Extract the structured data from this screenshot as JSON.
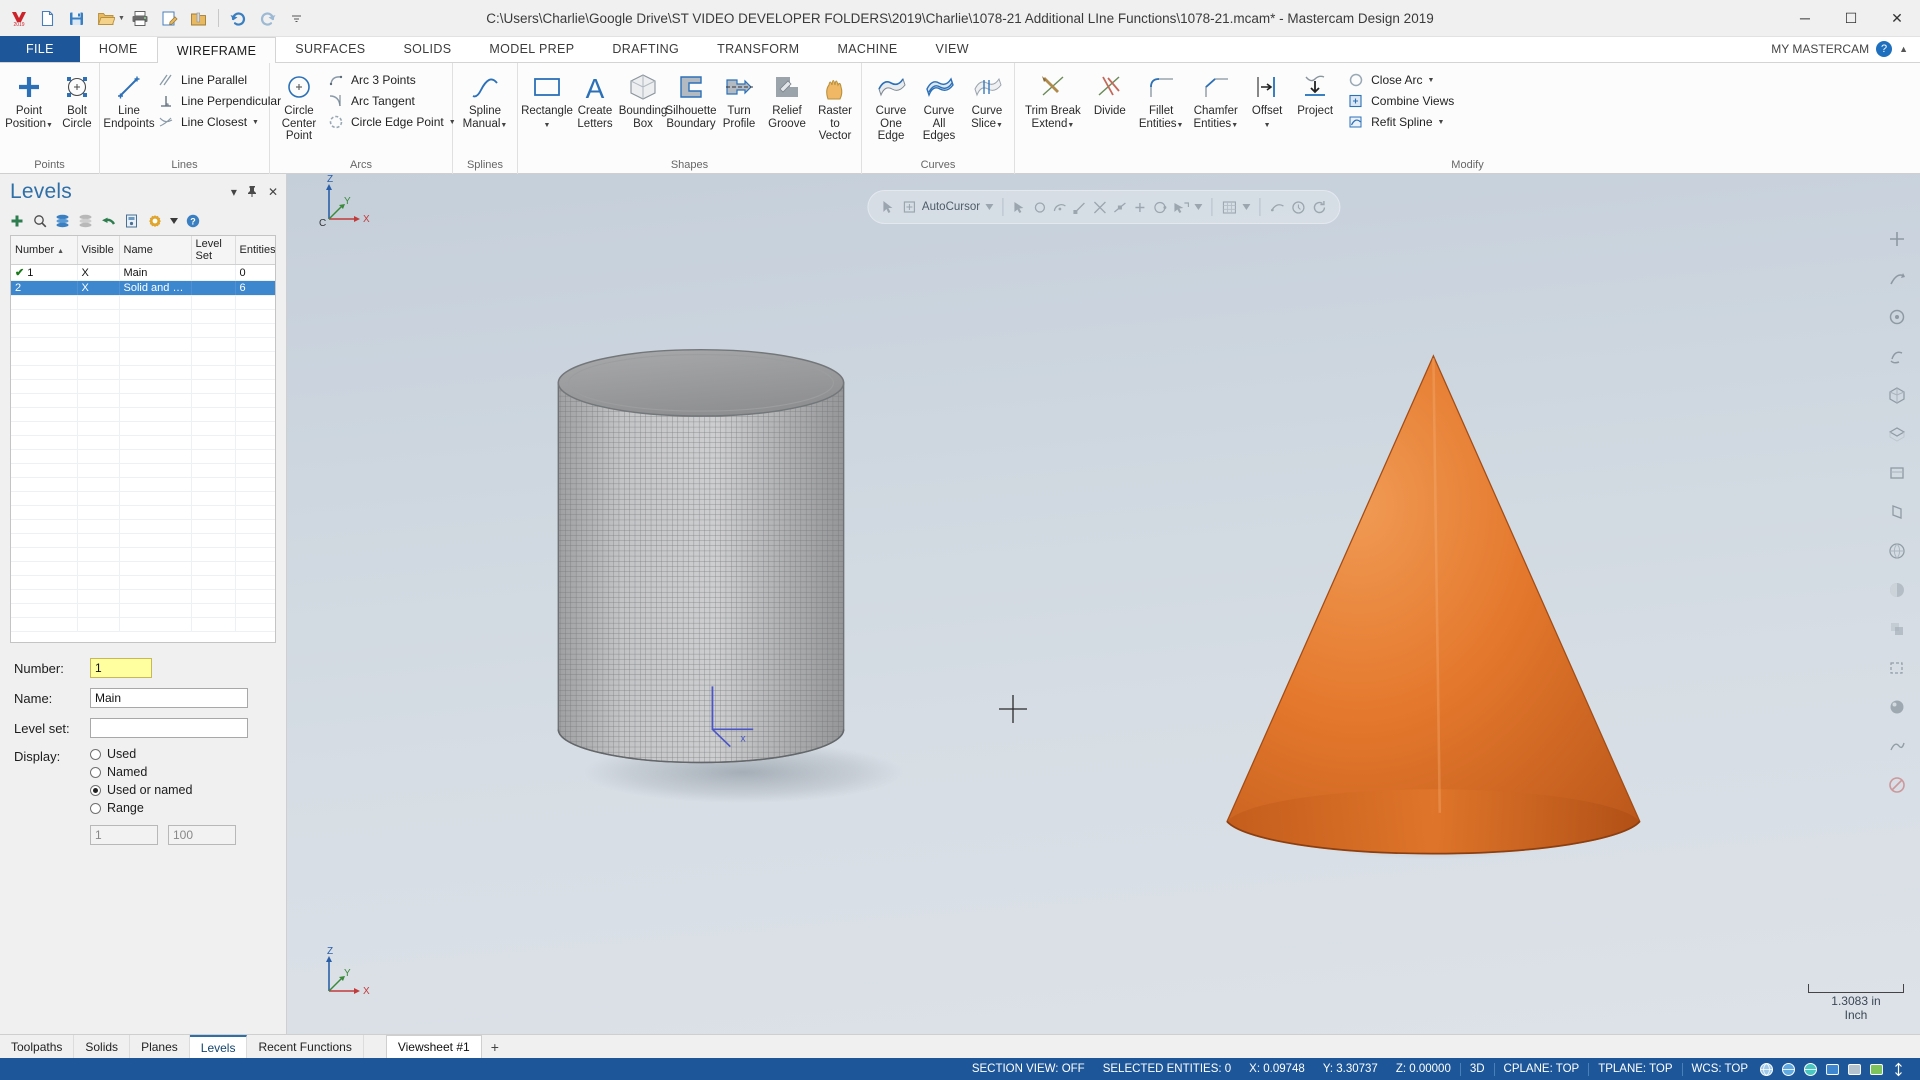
{
  "titlebar": {
    "title": "C:\\Users\\Charlie\\Google Drive\\ST VIDEO DEVELOPER FOLDERS\\2019\\Charlie\\1078-21 Additional LIne Functions\\1078-21.mcam* - Mastercam Design 2019",
    "quick_access": [
      {
        "name": "mastercam-logo-icon",
        "label": "Mastercam"
      },
      {
        "name": "new-file-icon",
        "label": "New"
      },
      {
        "name": "save-icon",
        "label": "Save"
      },
      {
        "name": "open-folder-icon",
        "label": "Open"
      },
      {
        "name": "print-icon",
        "label": "Print"
      },
      {
        "name": "print-preview-icon",
        "label": "Print Preview"
      },
      {
        "name": "zip2go-icon",
        "label": "Zip2Go"
      },
      {
        "name": "undo-icon",
        "label": "Undo"
      },
      {
        "name": "redo-icon",
        "label": "Redo"
      },
      {
        "name": "customize-qat-icon",
        "label": "Customize Quick Access Toolbar"
      }
    ],
    "window_controls": {
      "minimize": "─",
      "maximize": "☐",
      "close": "✕"
    }
  },
  "ribbon_tabs": {
    "file": "FILE",
    "tabs": [
      "HOME",
      "WIREFRAME",
      "SURFACES",
      "SOLIDS",
      "MODEL PREP",
      "DRAFTING",
      "TRANSFORM",
      "MACHINE",
      "VIEW"
    ],
    "active": "WIREFRAME",
    "my_mastercam": "MY MASTERCAM",
    "help": "?"
  },
  "ribbon": {
    "groups": [
      {
        "label": "Points",
        "big_buttons": [
          {
            "name": "point-position-button",
            "label": "Point\nPosition",
            "icon": "plus-icon",
            "has_caret": true
          },
          {
            "name": "bolt-circle-button",
            "label": "Bolt\nCircle",
            "icon": "bolt-circle-icon",
            "has_caret": false
          }
        ],
        "small_buttons": []
      },
      {
        "label": "Lines",
        "big_buttons": [
          {
            "name": "line-endpoints-button",
            "label": "Line\nEndpoints",
            "icon": "line-endpoints-icon",
            "has_caret": false
          }
        ],
        "small_buttons": [
          {
            "name": "line-parallel-button",
            "label": "Line Parallel",
            "icon": "line-parallel-icon",
            "has_caret": false
          },
          {
            "name": "line-perpendicular-button",
            "label": "Line Perpendicular",
            "icon": "line-perpendicular-icon",
            "has_caret": false
          },
          {
            "name": "line-closest-button",
            "label": "Line Closest",
            "icon": "line-closest-icon",
            "has_caret": true
          }
        ]
      },
      {
        "label": "Arcs",
        "big_buttons": [
          {
            "name": "circle-center-point-button",
            "label": "Circle\nCenter Point",
            "icon": "circle-center-icon",
            "has_caret": false
          }
        ],
        "small_buttons": [
          {
            "name": "arc-3-points-button",
            "label": "Arc 3 Points",
            "icon": "arc-3-points-icon",
            "has_caret": false
          },
          {
            "name": "arc-tangent-button",
            "label": "Arc Tangent",
            "icon": "arc-tangent-icon",
            "has_caret": false
          },
          {
            "name": "circle-edge-point-button",
            "label": "Circle Edge Point",
            "icon": "circle-edge-point-icon",
            "has_caret": true
          }
        ]
      },
      {
        "label": "Splines",
        "big_buttons": [
          {
            "name": "spline-manual-button",
            "label": "Spline\nManual",
            "icon": "spline-icon",
            "has_caret": true
          }
        ],
        "small_buttons": []
      },
      {
        "label": "Shapes",
        "big_buttons": [
          {
            "name": "rectangle-button",
            "label": "Rectangle",
            "icon": "rectangle-icon",
            "has_caret": true
          },
          {
            "name": "create-letters-button",
            "label": "Create\nLetters",
            "icon": "letter-a-icon",
            "has_caret": false
          },
          {
            "name": "bounding-box-button",
            "label": "Bounding\nBox",
            "icon": "bounding-box-icon",
            "has_caret": false
          },
          {
            "name": "silhouette-boundary-button",
            "label": "Silhouette\nBoundary",
            "icon": "silhouette-boundary-icon",
            "has_caret": false
          },
          {
            "name": "turn-profile-button",
            "label": "Turn\nProfile",
            "icon": "turn-profile-icon",
            "has_caret": false
          },
          {
            "name": "relief-groove-button",
            "label": "Relief\nGroove",
            "icon": "relief-groove-icon",
            "has_caret": false
          },
          {
            "name": "raster-to-vector-button",
            "label": "Raster to\nVector",
            "icon": "raster-to-vector-icon",
            "has_caret": false
          }
        ],
        "small_buttons": []
      },
      {
        "label": "Curves",
        "big_buttons": [
          {
            "name": "curve-one-edge-button",
            "label": "Curve\nOne Edge",
            "icon": "curve-one-edge-icon",
            "has_caret": false
          },
          {
            "name": "curve-all-edges-button",
            "label": "Curve\nAll Edges",
            "icon": "curve-all-edges-icon",
            "has_caret": false
          },
          {
            "name": "curve-slice-button",
            "label": "Curve\nSlice",
            "icon": "curve-slice-icon",
            "has_caret": true
          }
        ],
        "small_buttons": []
      },
      {
        "label": "Modify",
        "big_buttons": [
          {
            "name": "trim-break-extend-button",
            "label": "Trim Break\nExtend",
            "icon": "trim-break-extend-icon",
            "has_caret": true
          },
          {
            "name": "divide-button",
            "label": "Divide",
            "icon": "divide-icon",
            "has_caret": false
          },
          {
            "name": "fillet-entities-button",
            "label": "Fillet\nEntities",
            "icon": "fillet-icon",
            "has_caret": true
          },
          {
            "name": "chamfer-entities-button",
            "label": "Chamfer\nEntities",
            "icon": "chamfer-icon",
            "has_caret": true
          },
          {
            "name": "offset-button",
            "label": "Offset",
            "icon": "offset-icon",
            "has_caret": true
          },
          {
            "name": "project-button",
            "label": "Project",
            "icon": "project-icon",
            "has_caret": false
          }
        ],
        "small_buttons": [
          {
            "name": "close-arc-button",
            "label": "Close Arc",
            "icon": "close-arc-icon",
            "has_caret": true
          },
          {
            "name": "combine-views-button",
            "label": "Combine Views",
            "icon": "combine-views-icon",
            "has_caret": false
          },
          {
            "name": "refit-spline-button",
            "label": "Refit Spline",
            "icon": "refit-spline-icon",
            "has_caret": true
          }
        ]
      }
    ]
  },
  "levels_panel": {
    "title": "Levels",
    "header_icons": [
      {
        "name": "panel-dropdown-icon",
        "glyph": "▾"
      },
      {
        "name": "panel-pin-icon",
        "glyph": "📌"
      },
      {
        "name": "panel-close-icon",
        "glyph": "✕"
      }
    ],
    "toolbar_icons": [
      {
        "name": "add-level-icon",
        "label": "Add new level"
      },
      {
        "name": "find-level-icon",
        "label": "Find"
      },
      {
        "name": "visible-levels-icon",
        "label": "Make all levels visible"
      },
      {
        "name": "hide-levels-icon",
        "label": "Make all levels invisible"
      },
      {
        "name": "undo-levels-icon",
        "label": "Undo"
      },
      {
        "name": "level-options-icon",
        "label": "Level options"
      },
      {
        "name": "settings-gear-icon",
        "label": "Settings"
      },
      {
        "name": "settings-caret-icon",
        "label": "More"
      },
      {
        "name": "help-circle-icon",
        "label": "Help"
      }
    ],
    "table": {
      "columns": [
        "Number",
        "Visible",
        "Name",
        "Level Set",
        "Entities"
      ],
      "sort_column": "Number",
      "sort_dir": "asc",
      "rows": [
        {
          "check": "✔",
          "number": "1",
          "visible": "X",
          "name": "Main",
          "level_set": "",
          "entities": "0",
          "selected": false
        },
        {
          "check": "",
          "number": "2",
          "visible": "X",
          "name": "Solid and Sur...",
          "level_set": "",
          "entities": "6",
          "selected": true
        }
      ]
    },
    "fields": {
      "number_label": "Number:",
      "number_value": "1",
      "name_label": "Name:",
      "name_value": "Main",
      "level_set_label": "Level set:",
      "level_set_value": "",
      "display_label": "Display:",
      "display_options": [
        {
          "label": "Used",
          "selected": false
        },
        {
          "label": "Named",
          "selected": false
        },
        {
          "label": "Used or named",
          "selected": true
        },
        {
          "label": "Range",
          "selected": false
        }
      ],
      "range_from": "1",
      "range_to": "100"
    }
  },
  "viewport": {
    "autocursor": {
      "label": "AutoCursor",
      "items": [
        {
          "name": "autocursor-select-icon"
        },
        {
          "name": "autocursor-point-icon"
        },
        {
          "name": "autocursor-dropdown-caret"
        },
        {
          "name": "snap-origin-icon"
        },
        {
          "name": "snap-arc-center-icon"
        },
        {
          "name": "snap-endpoint-icon"
        },
        {
          "name": "snap-intersection-icon"
        },
        {
          "name": "snap-midpoint-icon"
        },
        {
          "name": "snap-point-icon"
        },
        {
          "name": "snap-quadrant-icon"
        },
        {
          "name": "snap-nearest-icon"
        },
        {
          "name": "snap-caret-icon"
        },
        {
          "name": "grid-snap-icon"
        },
        {
          "name": "grid-caret-icon"
        },
        {
          "name": "measure-icon"
        },
        {
          "name": "analyze-icon"
        },
        {
          "name": "refresh-icon"
        }
      ]
    },
    "triad_top": {
      "z": "Z",
      "y": "Y",
      "x": "X",
      "origin": "C"
    },
    "triad_bottom": {
      "z": "Z",
      "y": "Y",
      "x": "X"
    },
    "scale": {
      "value": "1.3083 in",
      "unit": "Inch"
    },
    "right_toolbar": [
      {
        "name": "fit-screen-icon"
      },
      {
        "name": "zoom-window-icon"
      },
      {
        "name": "zoom-target-icon"
      },
      {
        "name": "dynamic-rotate-icon"
      },
      {
        "name": "isometric-view-icon"
      },
      {
        "name": "top-view-icon"
      },
      {
        "name": "front-view-icon"
      },
      {
        "name": "right-view-icon"
      },
      {
        "name": "wireframe-shading-icon"
      },
      {
        "name": "shaded-view-icon"
      },
      {
        "name": "translucency-icon"
      },
      {
        "name": "hidden-lines-icon"
      },
      {
        "name": "material-icon"
      },
      {
        "name": "toolpath-display-icon"
      },
      {
        "name": "blank-entity-icon"
      }
    ],
    "models": [
      {
        "name": "cylinder-model",
        "color": "#b6b6b6",
        "shading": "wireframe-mesh"
      },
      {
        "name": "cone-model",
        "color": "#e0762a",
        "shading": "shaded"
      }
    ]
  },
  "bottom_tabs": {
    "tabs": [
      {
        "label": "Toolpaths",
        "active": false
      },
      {
        "label": "Solids",
        "active": false
      },
      {
        "label": "Planes",
        "active": false
      },
      {
        "label": "Levels",
        "active": true
      },
      {
        "label": "Recent Functions",
        "active": false
      }
    ],
    "viewsheet": "Viewsheet #1",
    "add_viewsheet": "+"
  },
  "statusbar": {
    "section_view": "SECTION VIEW: OFF",
    "selected_entities": "SELECTED ENTITIES: 0",
    "coords": [
      {
        "label": "X:",
        "value": "0.09748"
      },
      {
        "label": "Y:",
        "value": "3.30737"
      },
      {
        "label": "Z:",
        "value": "0.00000"
      }
    ],
    "mode_3d": "3D",
    "cplane": "CPLANE: TOP",
    "tplane": "TPLANE: TOP",
    "wcs": "WCS: TOP",
    "right_icons": [
      {
        "name": "globe-icon",
        "glyph": "⊕"
      },
      {
        "name": "globe-blue-icon",
        "glyph": "⊕"
      },
      {
        "name": "globe-teal-icon",
        "glyph": "⊕"
      },
      {
        "name": "display-blue-icon",
        "glyph": "■"
      },
      {
        "name": "display-grey-icon",
        "glyph": "■"
      },
      {
        "name": "display-green-icon",
        "glyph": "■"
      },
      {
        "name": "display-arrows-icon",
        "glyph": "↕"
      }
    ]
  },
  "colors": {
    "accent_blue": "#1e5799",
    "ribbon_bg": "#fcfcfc",
    "panel_bg": "#f0f0f0",
    "selection_blue": "#3c87cd",
    "highlight_yellow": "#ffffa0",
    "cone_orange": "#e0762a",
    "cylinder_grey": "#b6b6b6"
  }
}
